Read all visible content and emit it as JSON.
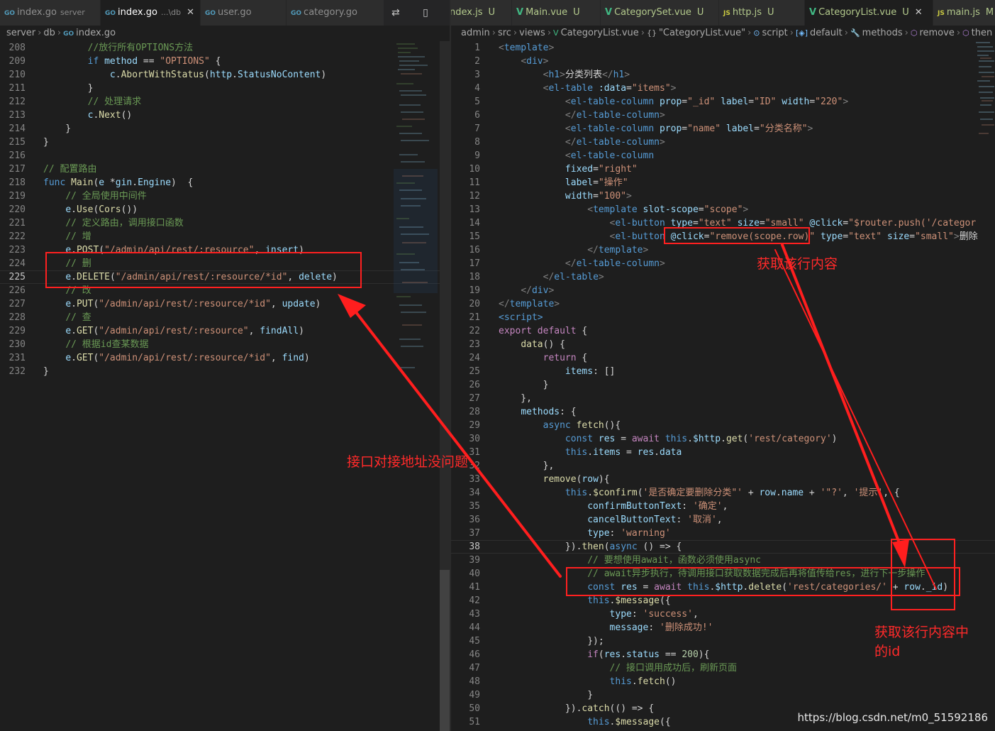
{
  "left_tabs": [
    {
      "icon": "GO",
      "name": "index.go",
      "desc": "server"
    },
    {
      "icon": "GO",
      "name": "index.go",
      "desc": "...\\db",
      "close": "✕"
    },
    {
      "icon": "GO",
      "name": "user.go"
    },
    {
      "icon": "GO",
      "name": "category.go"
    }
  ],
  "left_tab_actions": "⇄ ▯ ⋯",
  "right_tabs": [
    {
      "icon": "",
      "name": "ndex.js",
      "badge": "U"
    },
    {
      "icon": "V",
      "name": "Main.vue",
      "badge": "U"
    },
    {
      "icon": "V",
      "name": "CategorySet.vue",
      "badge": "U"
    },
    {
      "icon": "JS",
      "name": "http.js",
      "badge": "U"
    },
    {
      "icon": "V",
      "name": "CategoryList.vue",
      "badge": "U",
      "close": "✕"
    },
    {
      "icon": "JS",
      "name": "main.js",
      "badge": "M"
    }
  ],
  "left_breadcrumb": [
    "server",
    "db",
    "index.go"
  ],
  "right_breadcrumb": [
    "admin",
    "src",
    "views",
    "CategoryList.vue",
    "\"CategoryList.vue\"",
    "script",
    "default",
    "methods",
    "remove",
    "then"
  ],
  "left_code": [
    {
      "n": "208",
      "t": "        //放行所有OPTIONS方法"
    },
    {
      "n": "209",
      "t": "        if method == \"OPTIONS\" {"
    },
    {
      "n": "210",
      "t": "            c.AbortWithStatus(http.StatusNoContent)"
    },
    {
      "n": "211",
      "t": "        }"
    },
    {
      "n": "212",
      "t": "        // 处理请求"
    },
    {
      "n": "213",
      "t": "        c.Next()"
    },
    {
      "n": "214",
      "t": "    }"
    },
    {
      "n": "215",
      "t": "}"
    },
    {
      "n": "216",
      "t": ""
    },
    {
      "n": "217",
      "t": "// 配置路由"
    },
    {
      "n": "218",
      "t": "func Main(e *gin.Engine)  {"
    },
    {
      "n": "219",
      "t": "    // 全局使用中间件"
    },
    {
      "n": "220",
      "t": "    e.Use(Cors())"
    },
    {
      "n": "221",
      "t": "    // 定义路由，调用接口函数"
    },
    {
      "n": "222",
      "t": "    // 增"
    },
    {
      "n": "223",
      "t": "    e.POST(\"/admin/api/rest/:resource\", insert)"
    },
    {
      "n": "224",
      "t": "    // 删"
    },
    {
      "n": "225",
      "t": "    e.DELETE(\"/admin/api/rest/:resource/*id\", delete)"
    },
    {
      "n": "226",
      "t": "    // 改"
    },
    {
      "n": "227",
      "t": "    e.PUT(\"/admin/api/rest/:resource/*id\", update)"
    },
    {
      "n": "228",
      "t": "    // 查"
    },
    {
      "n": "229",
      "t": "    e.GET(\"/admin/api/rest/:resource\", findAll)"
    },
    {
      "n": "230",
      "t": "    // 根据id查某数据"
    },
    {
      "n": "231",
      "t": "    e.GET(\"/admin/api/rest/:resource/*id\", find)"
    },
    {
      "n": "232",
      "t": "}"
    }
  ],
  "left_current_line": "225",
  "right_code": [
    {
      "n": "1",
      "t": "<template>"
    },
    {
      "n": "2",
      "t": "    <div>"
    },
    {
      "n": "3",
      "t": "        <h1>分类列表</h1>"
    },
    {
      "n": "4",
      "t": "        <el-table :data=\"items\">"
    },
    {
      "n": "5",
      "t": "            <el-table-column prop=\"_id\" label=\"ID\" width=\"220\">"
    },
    {
      "n": "6",
      "t": "            </el-table-column>"
    },
    {
      "n": "7",
      "t": "            <el-table-column prop=\"name\" label=\"分类名称\">"
    },
    {
      "n": "8",
      "t": "            </el-table-column>"
    },
    {
      "n": "9",
      "t": "            <el-table-column"
    },
    {
      "n": "10",
      "t": "            fixed=\"right\""
    },
    {
      "n": "11",
      "t": "            label=\"操作\""
    },
    {
      "n": "12",
      "t": "            width=\"100\">"
    },
    {
      "n": "13",
      "t": "                <template slot-scope=\"scope\">"
    },
    {
      "n": "14",
      "t": "                    <el-button type=\"text\" size=\"small\" @click=\"$router.push('/categor"
    },
    {
      "n": "15",
      "t": "                    <el-button @click=\"remove(scope.row)\" type=\"text\" size=\"small\">删除"
    },
    {
      "n": "16",
      "t": "                </template>"
    },
    {
      "n": "17",
      "t": "            </el-table-column>"
    },
    {
      "n": "18",
      "t": "        </el-table>"
    },
    {
      "n": "19",
      "t": "    </div>"
    },
    {
      "n": "20",
      "t": "</template>"
    },
    {
      "n": "21",
      "t": "<script>"
    },
    {
      "n": "22",
      "t": "export default {"
    },
    {
      "n": "23",
      "t": "    data() {"
    },
    {
      "n": "24",
      "t": "        return {"
    },
    {
      "n": "25",
      "t": "            items: []"
    },
    {
      "n": "26",
      "t": "        }"
    },
    {
      "n": "27",
      "t": "    },"
    },
    {
      "n": "28",
      "t": "    methods: {"
    },
    {
      "n": "29",
      "t": "        async fetch(){"
    },
    {
      "n": "30",
      "t": "            const res = await this.$http.get('rest/category')"
    },
    {
      "n": "31",
      "t": "            this.items = res.data"
    },
    {
      "n": "32",
      "t": "        },"
    },
    {
      "n": "33",
      "t": "        remove(row){"
    },
    {
      "n": "34",
      "t": "            this.$confirm('是否确定要删除分类\"' + row.name + '\"?', '提示', {"
    },
    {
      "n": "35",
      "t": "                confirmButtonText: '确定',"
    },
    {
      "n": "36",
      "t": "                cancelButtonText: '取消',"
    },
    {
      "n": "37",
      "t": "                type: 'warning'"
    },
    {
      "n": "38",
      "t": "            }).then(async () => {"
    },
    {
      "n": "39",
      "t": "                // 要想使用await，函数必须使用async"
    },
    {
      "n": "40",
      "t": "                // await异步执行，待调用接口获取数据完成后再将值传给res，进行下一步操作"
    },
    {
      "n": "41",
      "t": "                const res = await this.$http.delete('rest/categories/' + row._id)"
    },
    {
      "n": "42",
      "t": "                this.$message({"
    },
    {
      "n": "43",
      "t": "                    type: 'success',"
    },
    {
      "n": "44",
      "t": "                    message: '删除成功!'"
    },
    {
      "n": "45",
      "t": "                });"
    },
    {
      "n": "46",
      "t": "                if(res.status == 200){"
    },
    {
      "n": "47",
      "t": "                    // 接口调用成功后，刷新页面"
    },
    {
      "n": "48",
      "t": "                    this.fetch()"
    },
    {
      "n": "49",
      "t": "                }"
    },
    {
      "n": "50",
      "t": "            }).catch(() => {"
    },
    {
      "n": "51",
      "t": "                this.$message({"
    }
  ],
  "right_current_line": "38",
  "annotations": {
    "get_row": "获取该行内容",
    "api_ok": "接口对接地址没问题",
    "get_id_line1": "获取该行内容中",
    "get_id_line2": "的id"
  },
  "watermark": "https://blog.csdn.net/m0_51592186",
  "colors": {
    "highlight": "#ff2020",
    "background": "#1e1e1e"
  }
}
